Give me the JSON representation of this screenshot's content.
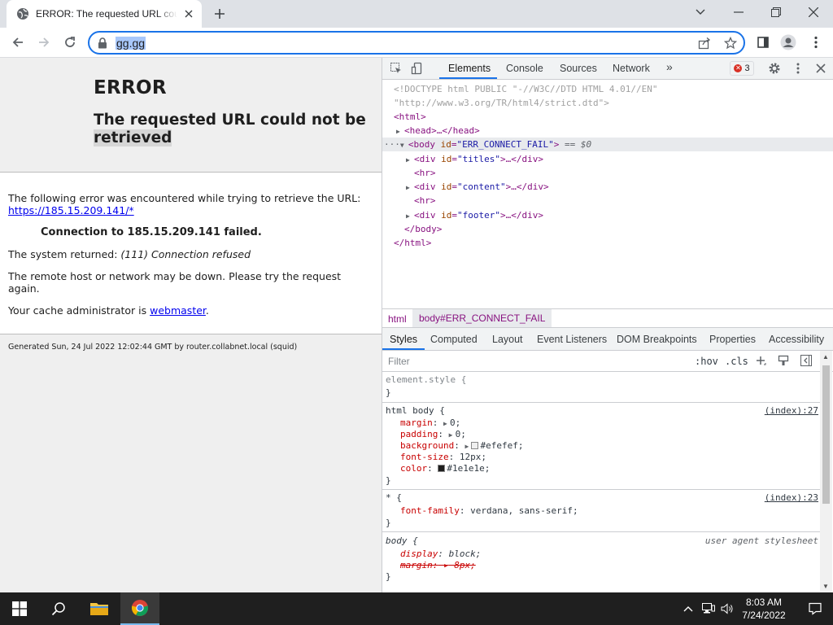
{
  "browser": {
    "tab_title": "ERROR: The requested URL could not be retrieved",
    "url": "gg.gg"
  },
  "page": {
    "heading": "ERROR",
    "subheading_part1": "The requested URL could not be",
    "subheading_part2": "retrieved",
    "line1": "The following error was encountered while trying to retrieve the URL:",
    "link_url": "https://185.15.209.141/*",
    "failed": "Connection to 185.15.209.141 failed.",
    "system_returned_prefix": "The system returned: ",
    "system_returned_value": "(111) Connection refused",
    "remote_host": "The remote host or network may be down. Please try the request again.",
    "cache_admin_prefix": "Your cache administrator is ",
    "cache_admin_link": "webmaster",
    "cache_admin_suffix": ".",
    "footer": "Generated Sun, 24 Jul 2022 12:02:44 GMT by router.collabnet.local (squid)"
  },
  "devtools": {
    "tabs": [
      "Elements",
      "Console",
      "Sources",
      "Network"
    ],
    "more_tabs": "»",
    "error_count": "3",
    "dom": {
      "doctype_1": "<!DOCTYPE html PUBLIC \"-//W3C//DTD HTML 4.01//EN\"",
      "doctype_2": "\"http://www.w3.org/TR/html4/strict.dtd\">",
      "html_open": "<html>",
      "head": "<head>…</head>",
      "body_tag": "<body ",
      "body_attr": "id",
      "body_val": "\"ERR_CONNECT_FAIL\"",
      "body_close": ">",
      "body_eq": " == $0",
      "div1_attr": "id",
      "div1_val": "\"titles\"",
      "hr": "<hr>",
      "div2_val": "\"content\"",
      "div3_val": "\"footer\"",
      "div_suffix": ">…</div>",
      "body_end": "</body>",
      "html_end": "</html>"
    },
    "breadcrumbs": [
      "html",
      "body#ERR_CONNECT_FAIL"
    ],
    "subtabs": [
      "Styles",
      "Computed",
      "Layout",
      "Event Listeners",
      "DOM Breakpoints",
      "Properties",
      "Accessibility"
    ],
    "filter_placeholder": "Filter",
    "hov": ":hov",
    "cls": ".cls",
    "styles": {
      "element_style": "element.style {",
      "close": "}",
      "rule1_selector": "html body {",
      "rule1_source": "(index):27",
      "rule1_props": [
        {
          "name": "margin",
          "value": "0;"
        },
        {
          "name": "padding",
          "value": "0;"
        },
        {
          "name": "background",
          "value": "#efefef;"
        },
        {
          "name": "font-size",
          "value": "12px;"
        },
        {
          "name": "color",
          "value": "#1e1e1e;"
        }
      ],
      "rule2_selector": "* {",
      "rule2_source": "(index):23",
      "rule2_prop": "font-family",
      "rule2_val": "verdana, sans-serif;",
      "rule3_selector": "body {",
      "rule3_source": "user agent stylesheet",
      "rule3_prop1": "display",
      "rule3_val1": "block;",
      "rule3_prop2": "margin:",
      "rule3_val2": "8px;"
    }
  },
  "taskbar": {
    "time": "8:03 AM",
    "date": "7/24/2022"
  },
  "colors": {
    "accent": "#1a73e8",
    "page_bg": "#efefef",
    "text": "#1e1e1e"
  }
}
